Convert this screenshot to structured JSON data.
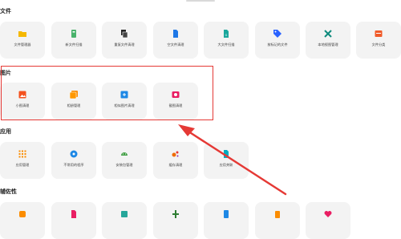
{
  "sections": {
    "files": {
      "title": "文件",
      "items": [
        {
          "label": "文件管理器",
          "icon": "folder-icon",
          "color": "#f5b800"
        },
        {
          "label": "新文件扫描",
          "icon": "new-file-scan-icon",
          "color": "#49b26b"
        },
        {
          "label": "重复文件清理",
          "icon": "duplicate-file-icon",
          "color": "#222222"
        },
        {
          "label": "空文件清理",
          "icon": "empty-file-icon",
          "color": "#1e78e6"
        },
        {
          "label": "大文件扫描",
          "icon": "large-file-icon",
          "color": "#1aa79c"
        },
        {
          "label": "按标记的文件",
          "icon": "tag-icon",
          "color": "#2962ff"
        },
        {
          "label": "本地视图管理",
          "icon": "tools-icon",
          "color": "#0e8a7d"
        },
        {
          "label": "文件分类",
          "icon": "file-category-icon",
          "color": "#f05a28"
        }
      ]
    },
    "pictures": {
      "title": "图片",
      "items": [
        {
          "label": "小图清理",
          "icon": "small-image-icon",
          "color": "#f4511e"
        },
        {
          "label": "相册管理",
          "icon": "album-icon",
          "color": "#fb8c00"
        },
        {
          "label": "相似图片清理",
          "icon": "similar-image-icon",
          "color": "#1e88e5"
        },
        {
          "label": "截图清理",
          "icon": "screenshot-icon",
          "color": "#e91e63"
        }
      ]
    },
    "apps": {
      "title": "应用",
      "items": [
        {
          "label": "应用管理",
          "icon": "app-grid-icon",
          "color": "#fb8c00"
        },
        {
          "label": "不常用的程序",
          "icon": "unused-app-icon",
          "color": "#1e88e5"
        },
        {
          "label": "安装包管理",
          "icon": "android-icon",
          "color": "#43a047"
        },
        {
          "label": "缓存清理",
          "icon": "cache-icon",
          "color": "#ef6c00"
        },
        {
          "label": "应用关联",
          "icon": "app-link-icon",
          "color": "#00acc1"
        }
      ]
    },
    "tools": {
      "title": "辅佐性",
      "items": [
        {
          "icon": "tool-orange-icon",
          "color": "#fb8c00"
        },
        {
          "icon": "tool-pink-icon",
          "color": "#e91e63"
        },
        {
          "icon": "tool-teal-icon",
          "color": "#26a69a"
        },
        {
          "icon": "tool-green-icon",
          "color": "#2e7d32"
        },
        {
          "icon": "tool-blue-icon",
          "color": "#1e88e5"
        },
        {
          "icon": "tool-orange2-icon",
          "color": "#fb8c00"
        },
        {
          "icon": "tool-heart-icon",
          "color": "#e91e63"
        }
      ]
    }
  },
  "annotation": {
    "color": "#e53935"
  }
}
